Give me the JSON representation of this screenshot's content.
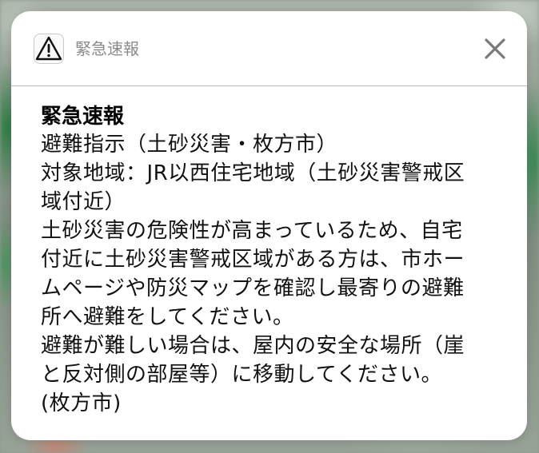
{
  "notification": {
    "app_name": "緊急速報",
    "app_icon": "warning-triangle-icon",
    "close_icon": "close-icon",
    "title": "緊急速報",
    "lines": [
      "避難指示（土砂災害・枚方市）",
      "対象地域：JR以西住宅地域（土砂災害警戒区",
      "域付近）",
      "土砂災害の危険性が高まっているため、自宅",
      "付近に土砂災害警戒区域がある方は、市ホー",
      "ムページや防災マップを確認し最寄りの避難",
      "所へ避難をしてください。",
      "避難が難しい場合は、屋内の安全な場所（崖",
      "と反対側の部屋等）に移動してください。",
      "(枚方市)"
    ]
  },
  "colors": {
    "card_background": "#ffffff",
    "app_name_text": "#8a8a8a",
    "close_icon": "#7a7a7a",
    "divider": "#bdbdbd"
  }
}
